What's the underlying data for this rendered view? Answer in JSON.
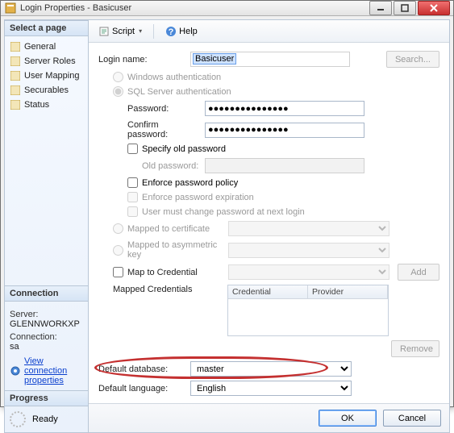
{
  "window": {
    "title": "Login Properties - Basicuser"
  },
  "toolbar": {
    "script": "Script",
    "help": "Help"
  },
  "sidebar": {
    "select_page_hdr": "Select a page",
    "items": [
      {
        "label": "General"
      },
      {
        "label": "Server Roles"
      },
      {
        "label": "User Mapping"
      },
      {
        "label": "Securables"
      },
      {
        "label": "Status"
      }
    ],
    "connection_hdr": "Connection",
    "server_lbl": "Server:",
    "server_val": "GLENNWORKXP",
    "conn_lbl": "Connection:",
    "conn_val": "sa",
    "view_conn_link": "View connection properties",
    "progress_hdr": "Progress",
    "progress_status": "Ready"
  },
  "form": {
    "login_name_lbl": "Login name:",
    "login_name_val": "Basicuser",
    "search_btn": "Search...",
    "auth_windows": "Windows authentication",
    "auth_sql": "SQL Server authentication",
    "password_lbl": "Password:",
    "password_val": "●●●●●●●●●●●●●●●",
    "confirm_lbl": "Confirm password:",
    "confirm_val": "●●●●●●●●●●●●●●●",
    "specify_old_lbl": "Specify old password",
    "old_password_lbl": "Old password:",
    "enforce_policy_lbl": "Enforce password policy",
    "enforce_expire_lbl": "Enforce password expiration",
    "must_change_lbl": "User must change password at next login",
    "mapped_cert_lbl": "Mapped to certificate",
    "mapped_asym_lbl": "Mapped to asymmetric key",
    "map_cred_lbl": "Map to Credential",
    "add_btn": "Add",
    "mapped_creds_lbl": "Mapped Credentials",
    "grid_col_cred": "Credential",
    "grid_col_prov": "Provider",
    "remove_btn": "Remove",
    "def_db_lbl": "Default database:",
    "def_db_val": "master",
    "def_lang_lbl": "Default language:",
    "def_lang_val": "English"
  },
  "footer": {
    "ok": "OK",
    "cancel": "Cancel"
  }
}
